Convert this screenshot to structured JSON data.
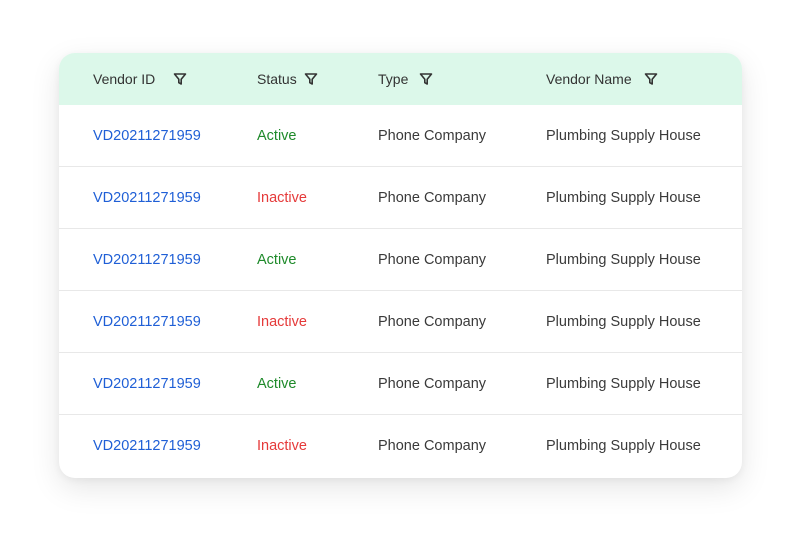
{
  "table": {
    "columns": [
      {
        "label": "Vendor ID",
        "filter_icon": "filter-icon"
      },
      {
        "label": "Status",
        "filter_icon": "filter-icon"
      },
      {
        "label": "Type",
        "filter_icon": "filter-icon"
      },
      {
        "label": "Vendor Name",
        "filter_icon": "filter-icon"
      }
    ],
    "rows": [
      {
        "vendor_id": "VD20211271959",
        "status": "Active",
        "type": "Phone Company",
        "vendor_name": "Plumbing Supply House"
      },
      {
        "vendor_id": "VD20211271959",
        "status": "Inactive",
        "type": "Phone Company",
        "vendor_name": "Plumbing Supply House"
      },
      {
        "vendor_id": "VD20211271959",
        "status": "Active",
        "type": "Phone Company",
        "vendor_name": "Plumbing Supply House"
      },
      {
        "vendor_id": "VD20211271959",
        "status": "Inactive",
        "type": "Phone Company",
        "vendor_name": "Plumbing Supply House"
      },
      {
        "vendor_id": "VD20211271959",
        "status": "Active",
        "type": "Phone Company",
        "vendor_name": "Plumbing Supply House"
      },
      {
        "vendor_id": "VD20211271959",
        "status": "Inactive",
        "type": "Phone Company",
        "vendor_name": "Plumbing Supply House"
      }
    ]
  },
  "colors": {
    "header_bg": "#dcf8ea",
    "link": "#1f5fd6",
    "active": "#1e8a2a",
    "inactive": "#e53a3a"
  }
}
